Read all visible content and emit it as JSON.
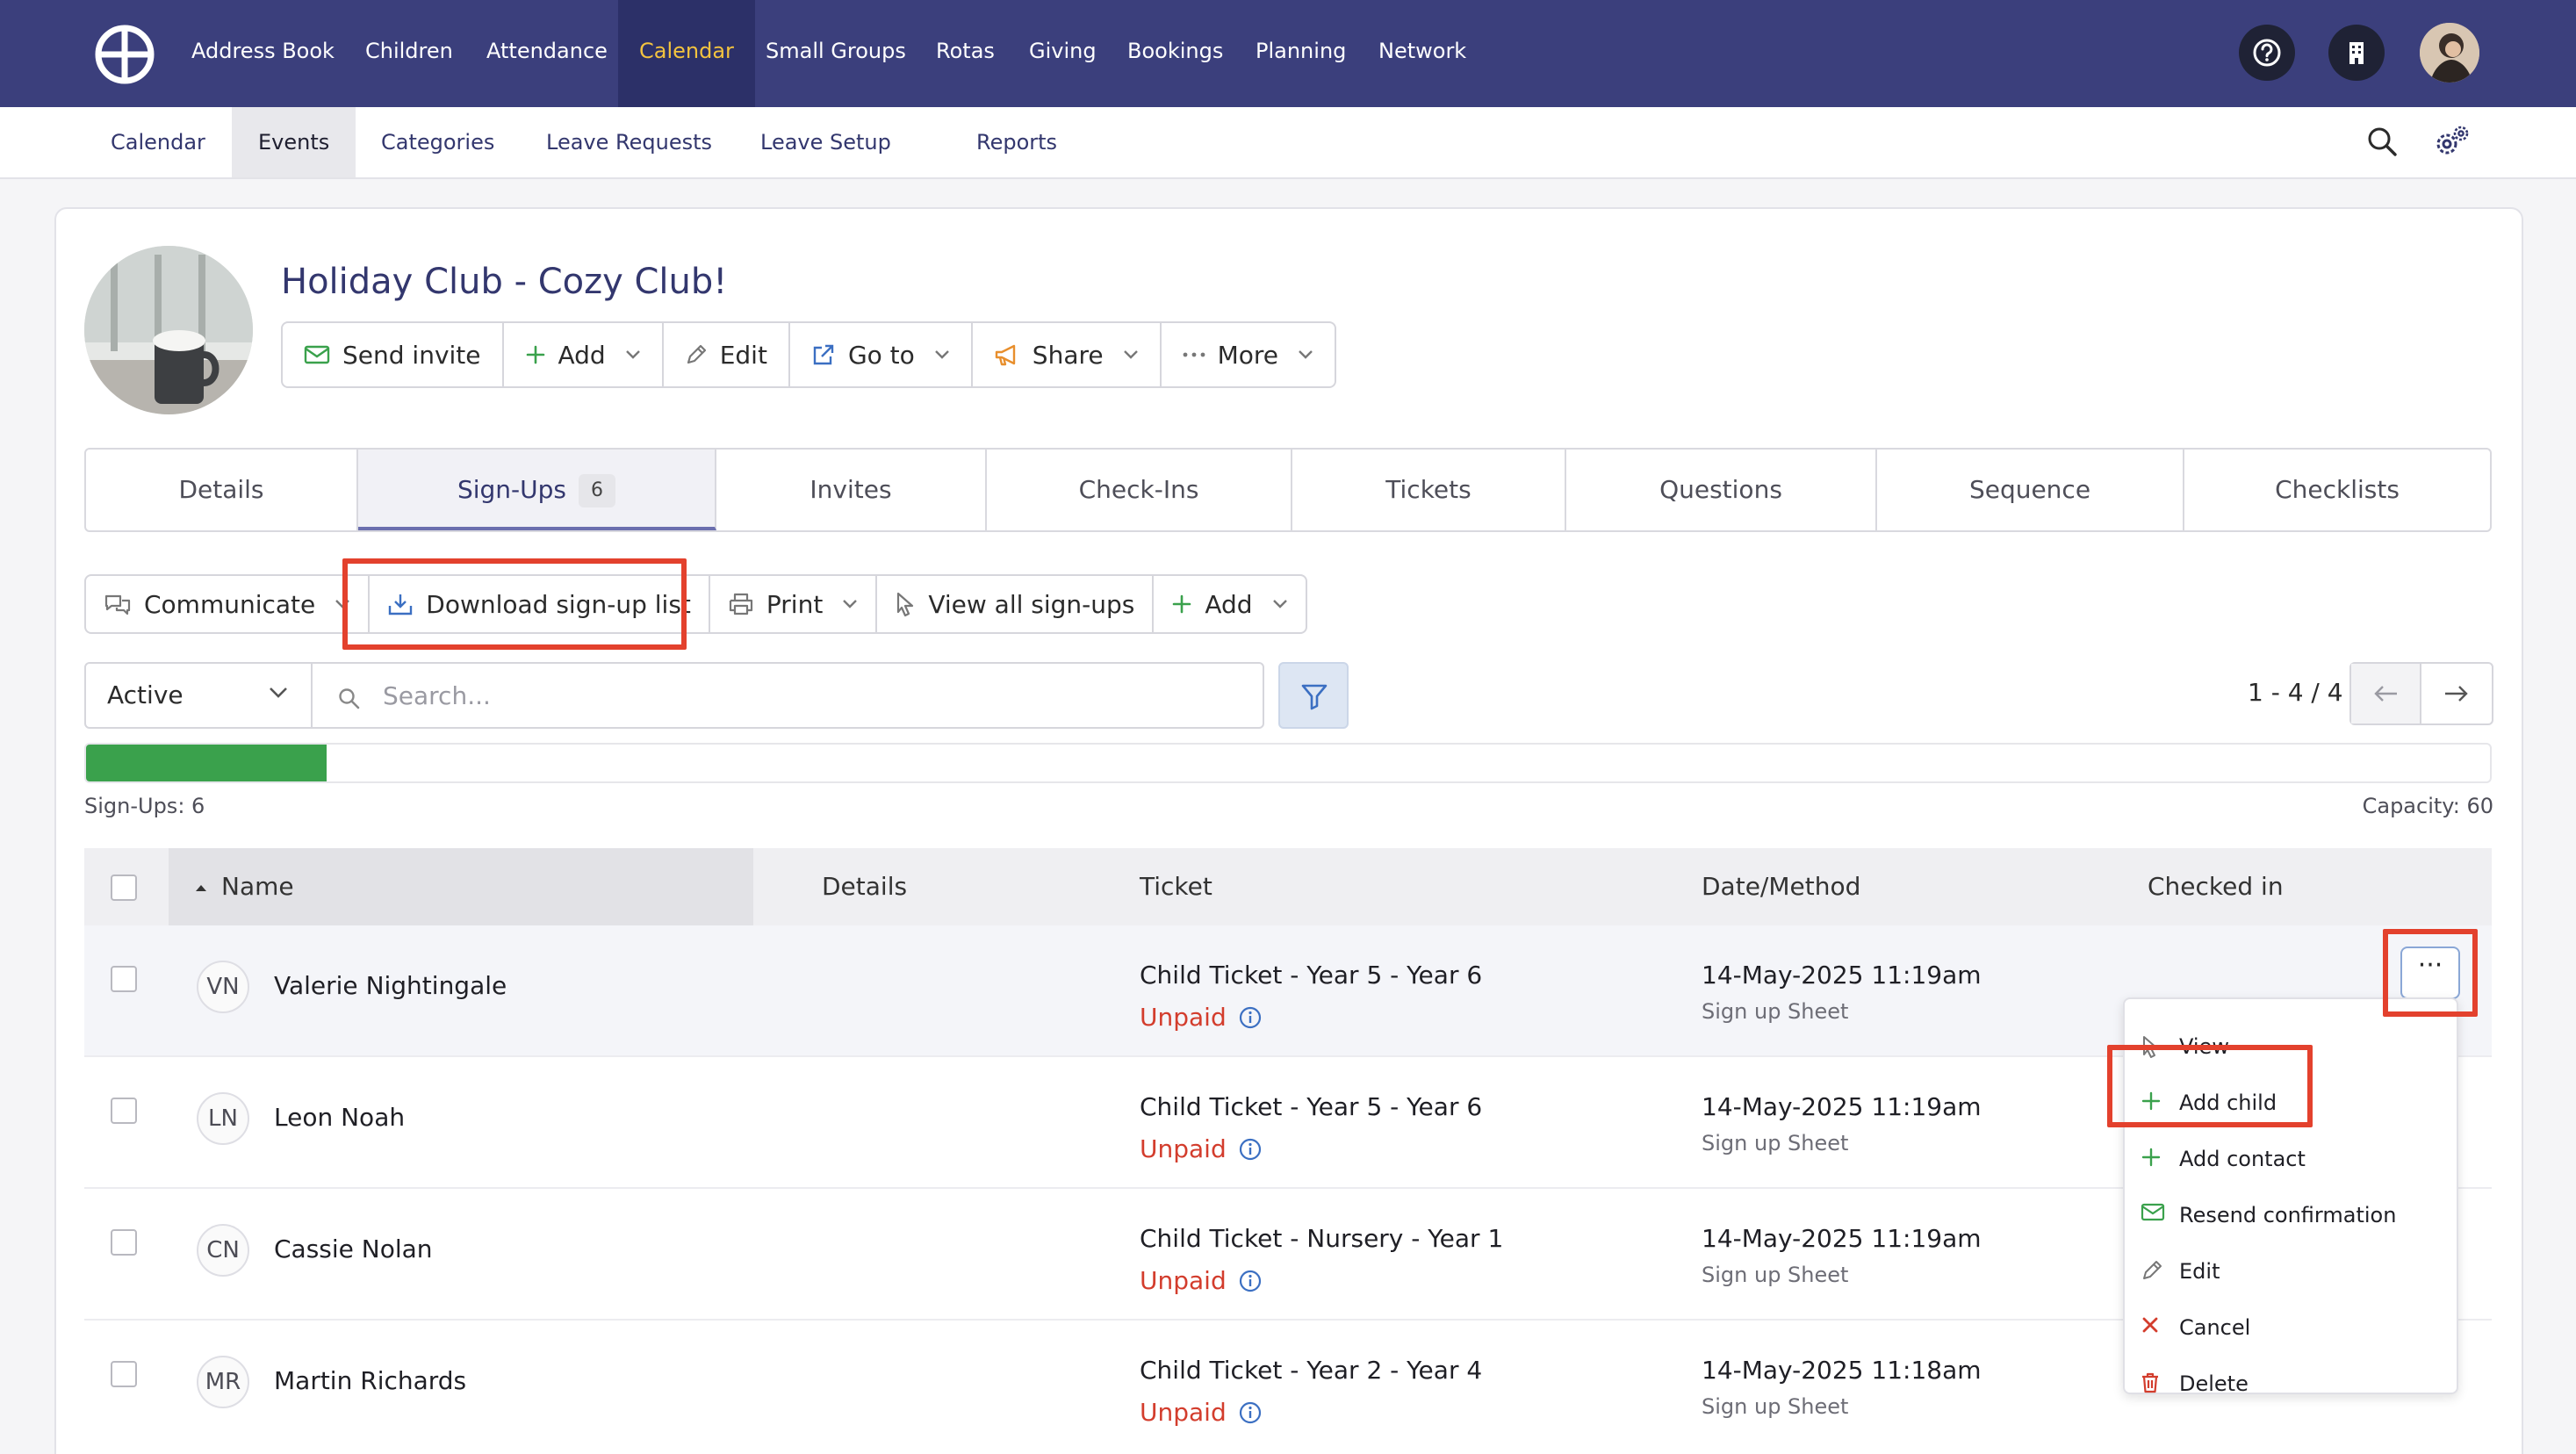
{
  "topnav": {
    "items": [
      "Address Book",
      "Children",
      "Attendance",
      "Calendar",
      "Small Groups",
      "Rotas",
      "Giving",
      "Bookings",
      "Planning",
      "Network"
    ],
    "active": "Calendar"
  },
  "subnav": {
    "items": [
      "Calendar",
      "Events",
      "Categories",
      "Leave Requests",
      "Leave Setup",
      "Reports"
    ],
    "active": "Events"
  },
  "event": {
    "title": "Holiday Club - Cozy Club!",
    "actions": [
      "Send invite",
      "Add",
      "Edit",
      "Go to",
      "Share",
      "More"
    ]
  },
  "tabs": {
    "items": [
      "Details",
      "Sign-Ups",
      "Invites",
      "Check-Ins",
      "Tickets",
      "Questions",
      "Sequence",
      "Checklists"
    ],
    "active": "Sign-Ups",
    "signups_count": "6"
  },
  "toolbar": {
    "actions": [
      "Communicate",
      "Download sign-up list",
      "Print",
      "View all sign-ups",
      "Add"
    ]
  },
  "filter": {
    "status": "Active",
    "search_placeholder": "Search..."
  },
  "pagination": {
    "range": "1 - 4 / 4"
  },
  "capacity": {
    "signups_label": "Sign-Ups: 6",
    "capacity_label": "Capacity: 60",
    "signups": 6,
    "capacity": 60
  },
  "table": {
    "columns": [
      "Name",
      "Details",
      "Ticket",
      "Date/Method",
      "Checked in"
    ],
    "rows": [
      {
        "initials": "VN",
        "name": "Valerie Nightingale",
        "ticket": "Child Ticket - Year 5 - Year 6",
        "payment": "Unpaid",
        "date": "14-May-2025 11:19am",
        "method": "Sign up Sheet"
      },
      {
        "initials": "LN",
        "name": "Leon Noah",
        "ticket": "Child Ticket - Year 5 - Year 6",
        "payment": "Unpaid",
        "date": "14-May-2025 11:19am",
        "method": "Sign up Sheet"
      },
      {
        "initials": "CN",
        "name": "Cassie Nolan",
        "ticket": "Child Ticket - Nursery - Year 1",
        "payment": "Unpaid",
        "date": "14-May-2025 11:19am",
        "method": "Sign up Sheet"
      },
      {
        "initials": "MR",
        "name": "Martin Richards",
        "ticket": "Child Ticket - Year 2 - Year 4",
        "payment": "Unpaid",
        "date": "14-May-2025 11:18am",
        "method": "Sign up Sheet"
      }
    ]
  },
  "row_menu": {
    "trigger": "···",
    "items": [
      "View",
      "Add child",
      "Add contact",
      "Resend confirmation",
      "Edit",
      "Cancel",
      "Delete"
    ]
  },
  "colors": {
    "nav_bg": "#3b3f7c",
    "nav_active_text": "#f3c33f",
    "link": "#33376e",
    "capacity_fill": "#3aa14c",
    "unpaid": "#d33d2d",
    "highlight": "#e3412d"
  }
}
